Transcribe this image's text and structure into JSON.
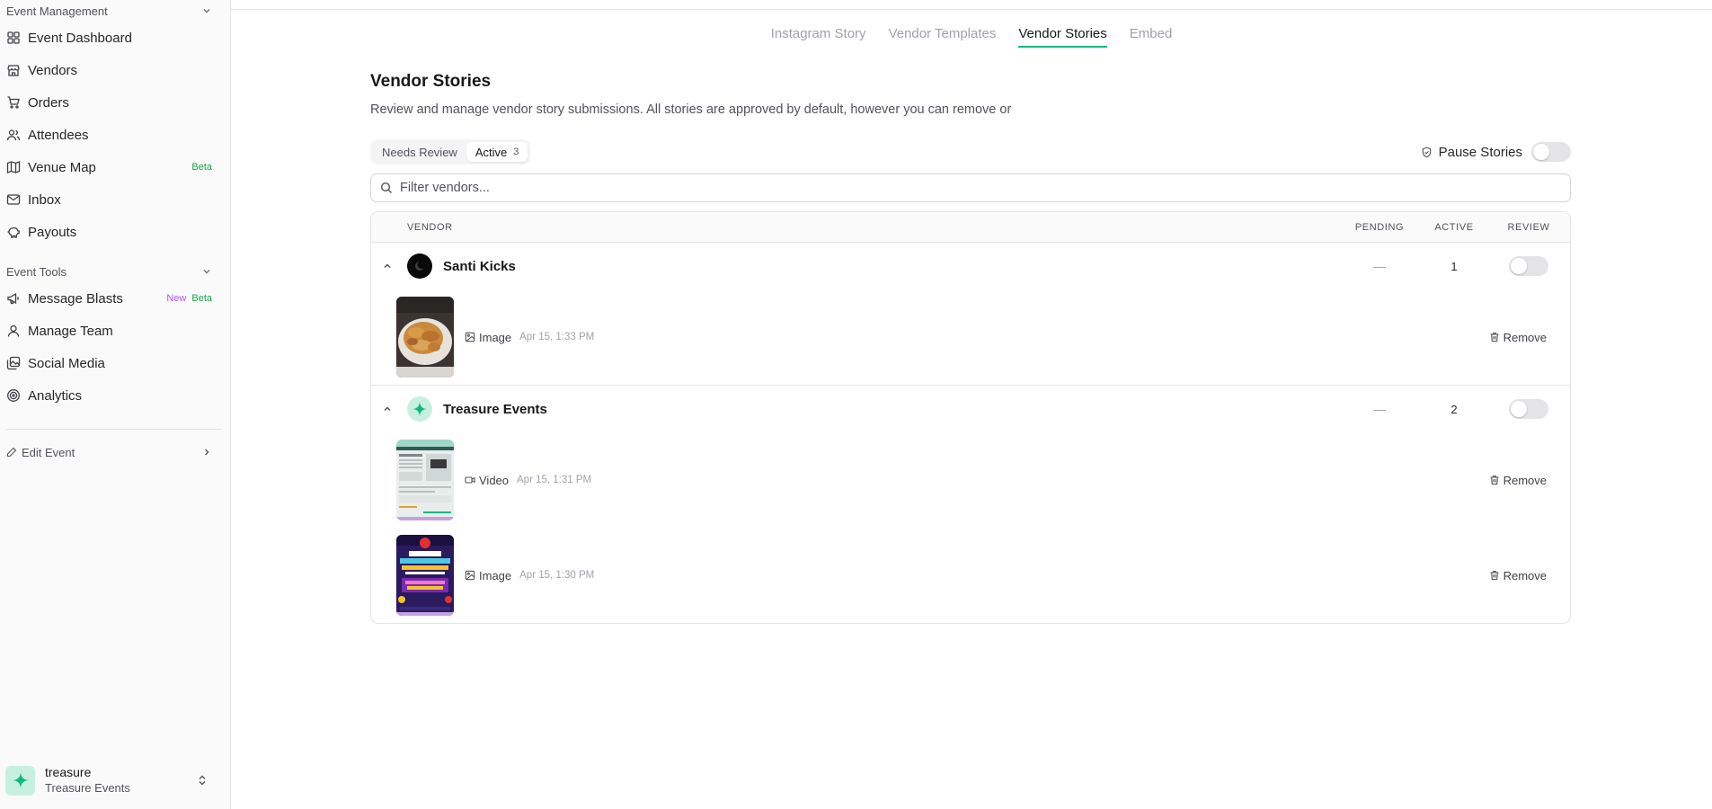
{
  "sidebar": {
    "section_event_management": "Event Management",
    "items": [
      {
        "label": "Event Dashboard",
        "icon": "grid-icon"
      },
      {
        "label": "Vendors",
        "icon": "store-icon"
      },
      {
        "label": "Orders",
        "icon": "cart-icon"
      },
      {
        "label": "Attendees",
        "icon": "users-icon"
      },
      {
        "label": "Venue Map",
        "icon": "map-icon",
        "badge": "Beta"
      },
      {
        "label": "Inbox",
        "icon": "mail-icon"
      },
      {
        "label": "Payouts",
        "icon": "piggy-bank-icon"
      }
    ],
    "section_event_tools": "Event Tools",
    "tools": [
      {
        "label": "Message Blasts",
        "icon": "megaphone-icon",
        "badge_new": "New",
        "badge_beta": "Beta"
      },
      {
        "label": "Manage Team",
        "icon": "user-icon"
      },
      {
        "label": "Social Media",
        "icon": "images-icon"
      },
      {
        "label": "Analytics",
        "icon": "target-icon"
      }
    ],
    "edit_event": "Edit Event",
    "user": {
      "name": "treasure",
      "org": "Treasure Events"
    }
  },
  "tabs": [
    {
      "label": "Instagram Story",
      "active": false
    },
    {
      "label": "Vendor Templates",
      "active": false
    },
    {
      "label": "Vendor Stories",
      "active": true
    },
    {
      "label": "Embed",
      "active": false
    }
  ],
  "page": {
    "title": "Vendor Stories",
    "description": "Review and manage vendor story submissions. All stories are approved by default, however you can remove or"
  },
  "filter_tabs": {
    "needs_review": "Needs Review",
    "active": "Active",
    "active_count": "3"
  },
  "pause_label": "Pause Stories",
  "search": {
    "placeholder": "Filter vendors...",
    "value": ""
  },
  "table": {
    "headers": {
      "vendor": "VENDOR",
      "pending": "PENDING",
      "active": "ACTIVE",
      "review": "REVIEW"
    },
    "groups": [
      {
        "name": "Santi Kicks",
        "pending": "—",
        "active": "1",
        "stories": [
          {
            "type": "Image",
            "date": "Apr 15, 1:33 PM",
            "remove": "Remove"
          }
        ]
      },
      {
        "name": "Treasure Events",
        "pending": "—",
        "active": "2",
        "stories": [
          {
            "type": "Video",
            "date": "Apr 15, 1:31 PM",
            "remove": "Remove"
          },
          {
            "type": "Image",
            "date": "Apr 15, 1:30 PM",
            "remove": "Remove"
          }
        ]
      }
    ]
  },
  "colors": {
    "accent": "#10b981",
    "beta": "#16a34a",
    "new": "#a855f7"
  }
}
